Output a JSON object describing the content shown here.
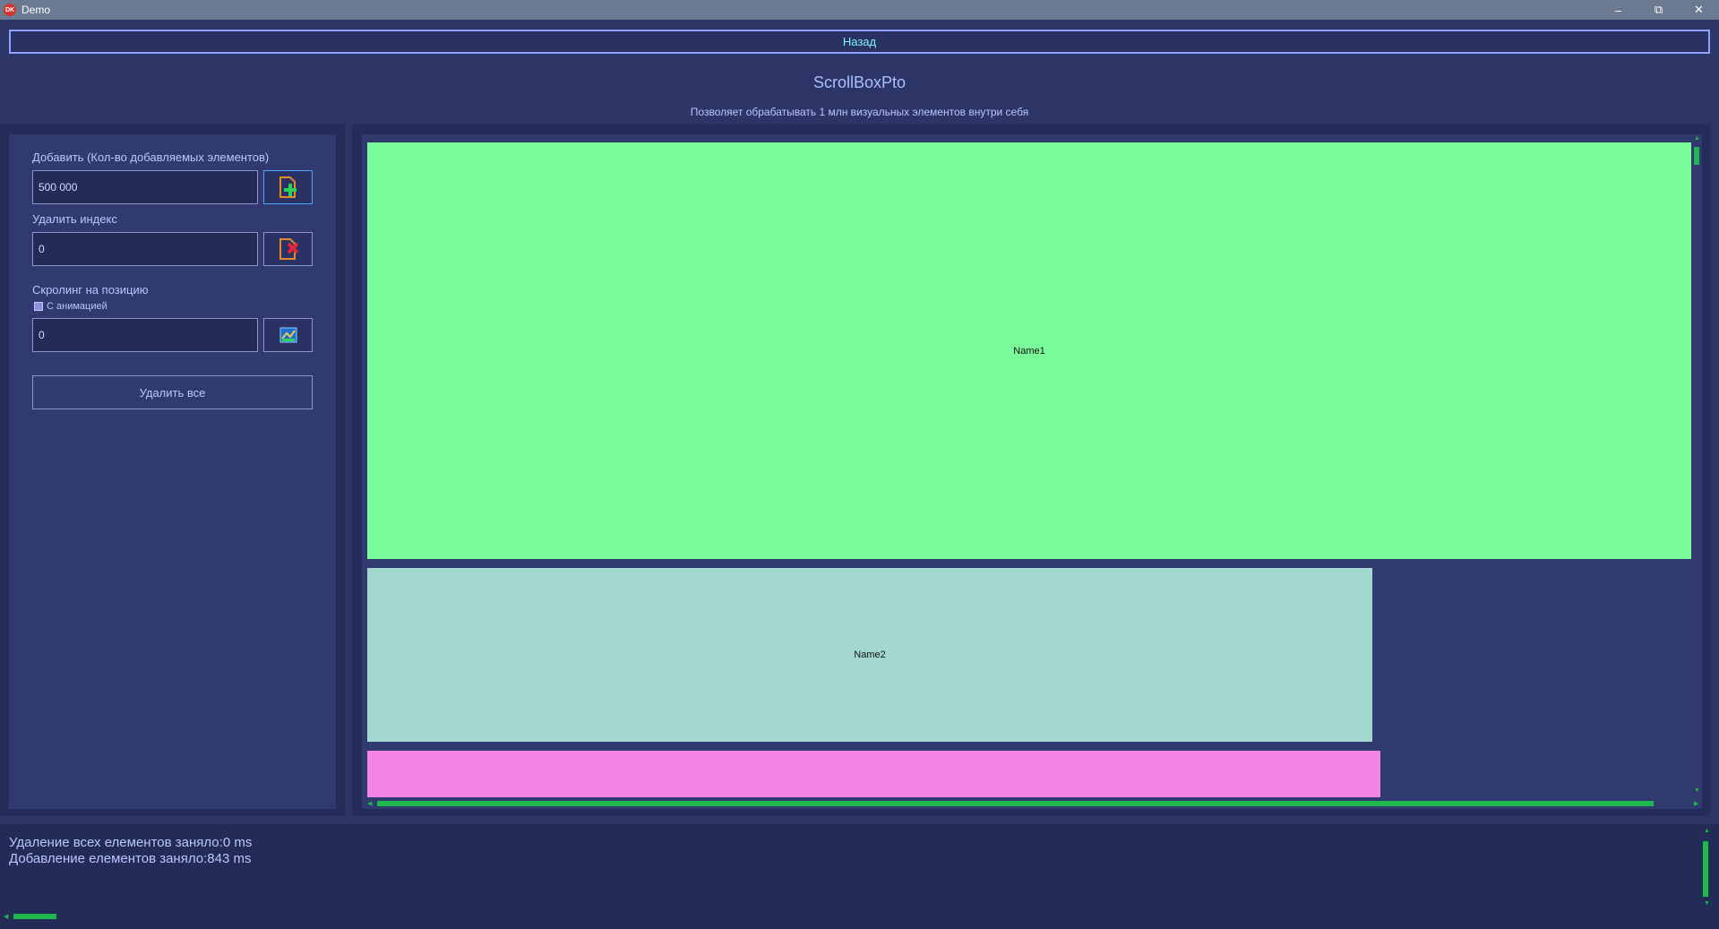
{
  "window": {
    "app_icon": "DK",
    "title": "Demo",
    "minimize_icon": "minimize-icon",
    "restore_icon": "restore-icon",
    "close_icon": "close-icon"
  },
  "nav": {
    "back_label": "Назад"
  },
  "header": {
    "title": "ScrollBoxPto",
    "subtitle": "Позволяет обрабатывать 1 млн визуальных элементов внутри себя"
  },
  "controls": {
    "add_label": "Добавить (Кол-во добавляемых элементов)",
    "add_value": "500 000",
    "add_icon": "add-file-icon",
    "delete_label": "Удалить индекс",
    "delete_value": "0",
    "delete_icon": "delete-file-icon",
    "scroll_label": "Скролинг на позицию",
    "animation_label": "С анимацией",
    "animation_checked": true,
    "scroll_value": "0",
    "scroll_icon": "scroll-to-icon",
    "delete_all_label": "Удалить все"
  },
  "scrollbox": {
    "items": [
      {
        "name": "Name1",
        "color": "#78fb98"
      },
      {
        "name": "Name2",
        "color": "#a2d8cf"
      },
      {
        "name": "",
        "color": "#f285e4"
      }
    ],
    "scrollbar_color": "#1eb84e"
  },
  "log": {
    "lines": [
      "Удаление всех елементов заняло:0 ms",
      "Добавление елементов заняло:843 ms"
    ]
  }
}
